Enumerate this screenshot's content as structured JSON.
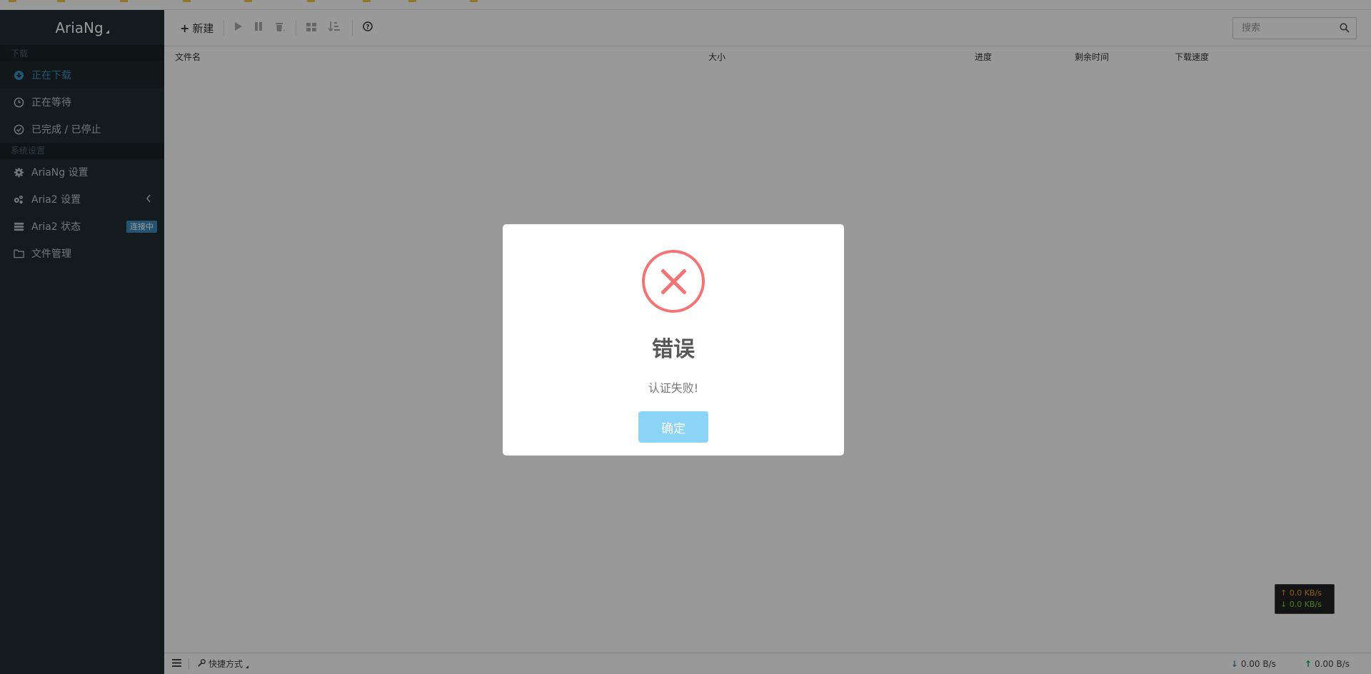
{
  "sidebar": {
    "logo": "AriaNg",
    "sections": {
      "download_header": "下载",
      "settings_header": "系统设置"
    },
    "items": [
      {
        "label": "正在下载"
      },
      {
        "label": "正在等待"
      },
      {
        "label": "已完成 / 已停止"
      },
      {
        "label": "AriaNg 设置"
      },
      {
        "label": "Aria2 设置"
      },
      {
        "label": "Aria2 状态",
        "badge": "连接中"
      },
      {
        "label": "文件管理"
      }
    ]
  },
  "toolbar": {
    "new_label": "新建",
    "search_placeholder": "搜索"
  },
  "table": {
    "columns": [
      "文件名",
      "大小",
      "进度",
      "剩余时间",
      "下载速度"
    ]
  },
  "footer": {
    "shortcut_label": "快捷方式",
    "download_speed": "0.00 B/s",
    "upload_speed": "0.00 B/s"
  },
  "mini_speed": {
    "up": "↑ 0.0 KB/s",
    "down": "↓ 0.0 KB/s"
  },
  "dialog": {
    "title": "错误",
    "message": "认证失败!",
    "confirm": "确定"
  },
  "colors": {
    "sidebar_bg": "#222d32",
    "accent": "#3c8dbc",
    "error": "#f27474",
    "confirm_button": "#8cd4f5"
  }
}
